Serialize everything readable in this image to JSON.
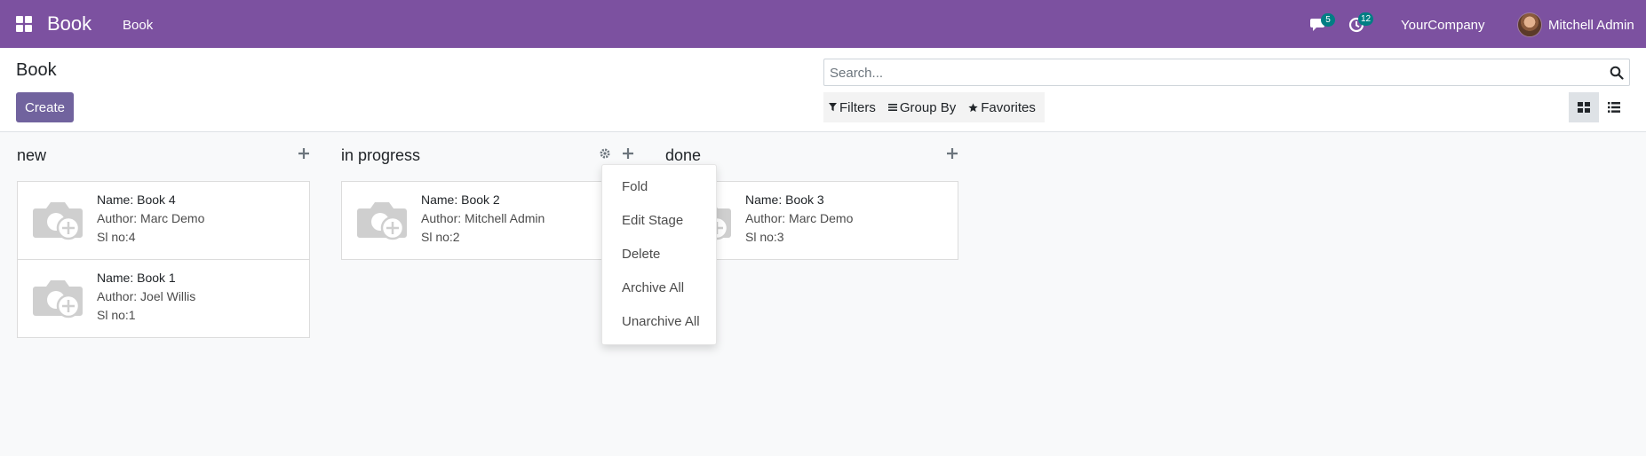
{
  "navbar": {
    "brand": "Book",
    "menu_item": "Book",
    "chat_count": "5",
    "activity_count": "12",
    "company": "YourCompany",
    "user": "Mitchell Admin",
    "color": "#7c51a0"
  },
  "control_panel": {
    "title": "Book",
    "create_label": "Create",
    "search_placeholder": "Search...",
    "filters_label": "Filters",
    "groupby_label": "Group By",
    "favorites_label": "Favorites"
  },
  "columns": [
    {
      "title": "new",
      "cards": [
        {
          "name": "Name: Book 4",
          "author": "Author: Marc Demo",
          "slno": "Sl no:4"
        },
        {
          "name": "Name: Book 1",
          "author": "Author: Joel Willis",
          "slno": "Sl no:1"
        }
      ]
    },
    {
      "title": "in progress",
      "cards": [
        {
          "name": "Name: Book 2",
          "author": "Author: Mitchell Admin",
          "slno": "Sl no:2"
        }
      ]
    },
    {
      "title": "done",
      "cards": [
        {
          "name": "Name: Book 3",
          "author": "Author: Marc Demo",
          "slno": "Sl no:3"
        }
      ]
    }
  ],
  "stage_menu": {
    "items": [
      "Fold",
      "Edit Stage",
      "Delete",
      "Archive All",
      "Unarchive All"
    ]
  }
}
